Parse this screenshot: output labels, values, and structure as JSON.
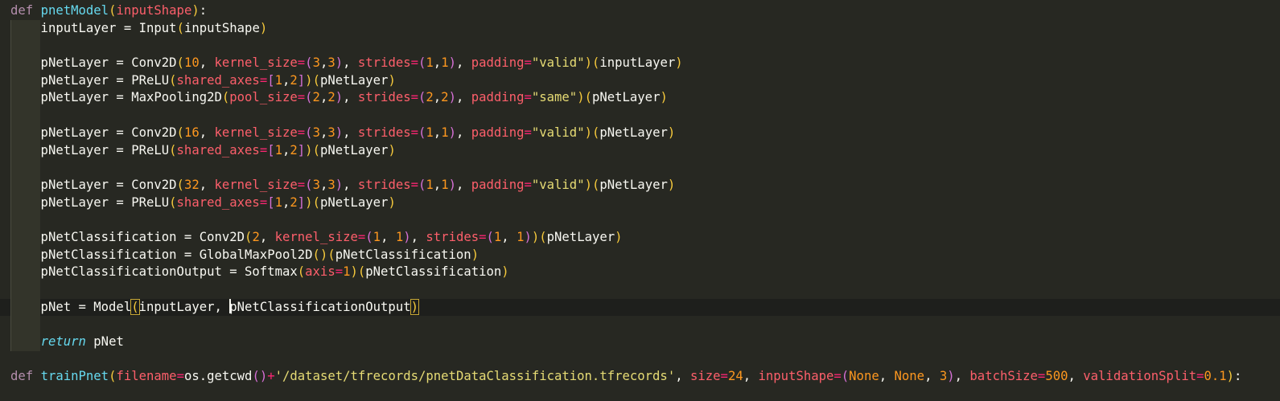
{
  "editor": {
    "lines": [
      {
        "id": 1,
        "indent": false,
        "current": false,
        "segments": [
          {
            "t": "def ",
            "c": "kw"
          },
          {
            "t": "pnetModel",
            "c": "fn"
          },
          {
            "t": "(",
            "c": "b1"
          },
          {
            "t": "inputShape",
            "c": "pa"
          },
          {
            "t": ")",
            "c": "b1"
          },
          {
            "t": ":",
            "c": "plain"
          }
        ]
      },
      {
        "id": 2,
        "indent": true,
        "current": false,
        "segments": [
          {
            "t": "    inputLayer ",
            "c": "plain"
          },
          {
            "t": "=",
            "c": "plain"
          },
          {
            "t": " Input",
            "c": "plain"
          },
          {
            "t": "(",
            "c": "b1"
          },
          {
            "t": "inputShape",
            "c": "plain"
          },
          {
            "t": ")",
            "c": "b1"
          }
        ]
      },
      {
        "id": 3,
        "indent": true,
        "current": false,
        "segments": []
      },
      {
        "id": 4,
        "indent": true,
        "current": false,
        "segments": [
          {
            "t": "    pNetLayer = Conv2D",
            "c": "plain"
          },
          {
            "t": "(",
            "c": "b1"
          },
          {
            "t": "10",
            "c": "num"
          },
          {
            "t": ", ",
            "c": "plain"
          },
          {
            "t": "kernel_size",
            "c": "pa"
          },
          {
            "t": "=",
            "c": "op"
          },
          {
            "t": "(",
            "c": "b2"
          },
          {
            "t": "3",
            "c": "num"
          },
          {
            "t": ",",
            "c": "plain"
          },
          {
            "t": "3",
            "c": "num"
          },
          {
            "t": ")",
            "c": "b2"
          },
          {
            "t": ", ",
            "c": "plain"
          },
          {
            "t": "strides",
            "c": "pa"
          },
          {
            "t": "=",
            "c": "op"
          },
          {
            "t": "(",
            "c": "b2"
          },
          {
            "t": "1",
            "c": "num"
          },
          {
            "t": ",",
            "c": "plain"
          },
          {
            "t": "1",
            "c": "num"
          },
          {
            "t": ")",
            "c": "b2"
          },
          {
            "t": ", ",
            "c": "plain"
          },
          {
            "t": "padding",
            "c": "pa"
          },
          {
            "t": "=",
            "c": "op"
          },
          {
            "t": "\"valid\"",
            "c": "str"
          },
          {
            "t": ")",
            "c": "b1"
          },
          {
            "t": "(",
            "c": "b1"
          },
          {
            "t": "inputLayer",
            "c": "plain"
          },
          {
            "t": ")",
            "c": "b1"
          }
        ]
      },
      {
        "id": 5,
        "indent": true,
        "current": false,
        "segments": [
          {
            "t": "    pNetLayer = PReLU",
            "c": "plain"
          },
          {
            "t": "(",
            "c": "b1"
          },
          {
            "t": "shared_axes",
            "c": "pa"
          },
          {
            "t": "=",
            "c": "op"
          },
          {
            "t": "[",
            "c": "b2"
          },
          {
            "t": "1",
            "c": "num"
          },
          {
            "t": ",",
            "c": "plain"
          },
          {
            "t": "2",
            "c": "num"
          },
          {
            "t": "]",
            "c": "b2"
          },
          {
            "t": ")",
            "c": "b1"
          },
          {
            "t": "(",
            "c": "b1"
          },
          {
            "t": "pNetLayer",
            "c": "plain"
          },
          {
            "t": ")",
            "c": "b1"
          }
        ]
      },
      {
        "id": 6,
        "indent": true,
        "current": false,
        "segments": [
          {
            "t": "    pNetLayer = MaxPooling2D",
            "c": "plain"
          },
          {
            "t": "(",
            "c": "b1"
          },
          {
            "t": "pool_size",
            "c": "pa"
          },
          {
            "t": "=",
            "c": "op"
          },
          {
            "t": "(",
            "c": "b2"
          },
          {
            "t": "2",
            "c": "num"
          },
          {
            "t": ",",
            "c": "plain"
          },
          {
            "t": "2",
            "c": "num"
          },
          {
            "t": ")",
            "c": "b2"
          },
          {
            "t": ", ",
            "c": "plain"
          },
          {
            "t": "strides",
            "c": "pa"
          },
          {
            "t": "=",
            "c": "op"
          },
          {
            "t": "(",
            "c": "b2"
          },
          {
            "t": "2",
            "c": "num"
          },
          {
            "t": ",",
            "c": "plain"
          },
          {
            "t": "2",
            "c": "num"
          },
          {
            "t": ")",
            "c": "b2"
          },
          {
            "t": ", ",
            "c": "plain"
          },
          {
            "t": "padding",
            "c": "pa"
          },
          {
            "t": "=",
            "c": "op"
          },
          {
            "t": "\"same\"",
            "c": "str"
          },
          {
            "t": ")",
            "c": "b1"
          },
          {
            "t": "(",
            "c": "b1"
          },
          {
            "t": "pNetLayer",
            "c": "plain"
          },
          {
            "t": ")",
            "c": "b1"
          }
        ]
      },
      {
        "id": 7,
        "indent": true,
        "current": false,
        "segments": []
      },
      {
        "id": 8,
        "indent": true,
        "current": false,
        "segments": [
          {
            "t": "    pNetLayer = Conv2D",
            "c": "plain"
          },
          {
            "t": "(",
            "c": "b1"
          },
          {
            "t": "16",
            "c": "num"
          },
          {
            "t": ", ",
            "c": "plain"
          },
          {
            "t": "kernel_size",
            "c": "pa"
          },
          {
            "t": "=",
            "c": "op"
          },
          {
            "t": "(",
            "c": "b2"
          },
          {
            "t": "3",
            "c": "num"
          },
          {
            "t": ",",
            "c": "plain"
          },
          {
            "t": "3",
            "c": "num"
          },
          {
            "t": ")",
            "c": "b2"
          },
          {
            "t": ", ",
            "c": "plain"
          },
          {
            "t": "strides",
            "c": "pa"
          },
          {
            "t": "=",
            "c": "op"
          },
          {
            "t": "(",
            "c": "b2"
          },
          {
            "t": "1",
            "c": "num"
          },
          {
            "t": ",",
            "c": "plain"
          },
          {
            "t": "1",
            "c": "num"
          },
          {
            "t": ")",
            "c": "b2"
          },
          {
            "t": ", ",
            "c": "plain"
          },
          {
            "t": "padding",
            "c": "pa"
          },
          {
            "t": "=",
            "c": "op"
          },
          {
            "t": "\"valid\"",
            "c": "str"
          },
          {
            "t": ")",
            "c": "b1"
          },
          {
            "t": "(",
            "c": "b1"
          },
          {
            "t": "pNetLayer",
            "c": "plain"
          },
          {
            "t": ")",
            "c": "b1"
          }
        ]
      },
      {
        "id": 9,
        "indent": true,
        "current": false,
        "segments": [
          {
            "t": "    pNetLayer = PReLU",
            "c": "plain"
          },
          {
            "t": "(",
            "c": "b1"
          },
          {
            "t": "shared_axes",
            "c": "pa"
          },
          {
            "t": "=",
            "c": "op"
          },
          {
            "t": "[",
            "c": "b2"
          },
          {
            "t": "1",
            "c": "num"
          },
          {
            "t": ",",
            "c": "plain"
          },
          {
            "t": "2",
            "c": "num"
          },
          {
            "t": "]",
            "c": "b2"
          },
          {
            "t": ")",
            "c": "b1"
          },
          {
            "t": "(",
            "c": "b1"
          },
          {
            "t": "pNetLayer",
            "c": "plain"
          },
          {
            "t": ")",
            "c": "b1"
          }
        ]
      },
      {
        "id": 10,
        "indent": true,
        "current": false,
        "segments": []
      },
      {
        "id": 11,
        "indent": true,
        "current": false,
        "segments": [
          {
            "t": "    pNetLayer = Conv2D",
            "c": "plain"
          },
          {
            "t": "(",
            "c": "b1"
          },
          {
            "t": "32",
            "c": "num"
          },
          {
            "t": ", ",
            "c": "plain"
          },
          {
            "t": "kernel_size",
            "c": "pa"
          },
          {
            "t": "=",
            "c": "op"
          },
          {
            "t": "(",
            "c": "b2"
          },
          {
            "t": "3",
            "c": "num"
          },
          {
            "t": ",",
            "c": "plain"
          },
          {
            "t": "3",
            "c": "num"
          },
          {
            "t": ")",
            "c": "b2"
          },
          {
            "t": ", ",
            "c": "plain"
          },
          {
            "t": "strides",
            "c": "pa"
          },
          {
            "t": "=",
            "c": "op"
          },
          {
            "t": "(",
            "c": "b2"
          },
          {
            "t": "1",
            "c": "num"
          },
          {
            "t": ",",
            "c": "plain"
          },
          {
            "t": "1",
            "c": "num"
          },
          {
            "t": ")",
            "c": "b2"
          },
          {
            "t": ", ",
            "c": "plain"
          },
          {
            "t": "padding",
            "c": "pa"
          },
          {
            "t": "=",
            "c": "op"
          },
          {
            "t": "\"valid\"",
            "c": "str"
          },
          {
            "t": ")",
            "c": "b1"
          },
          {
            "t": "(",
            "c": "b1"
          },
          {
            "t": "pNetLayer",
            "c": "plain"
          },
          {
            "t": ")",
            "c": "b1"
          }
        ]
      },
      {
        "id": 12,
        "indent": true,
        "current": false,
        "segments": [
          {
            "t": "    pNetLayer = PReLU",
            "c": "plain"
          },
          {
            "t": "(",
            "c": "b1"
          },
          {
            "t": "shared_axes",
            "c": "pa"
          },
          {
            "t": "=",
            "c": "op"
          },
          {
            "t": "[",
            "c": "b2"
          },
          {
            "t": "1",
            "c": "num"
          },
          {
            "t": ",",
            "c": "plain"
          },
          {
            "t": "2",
            "c": "num"
          },
          {
            "t": "]",
            "c": "b2"
          },
          {
            "t": ")",
            "c": "b1"
          },
          {
            "t": "(",
            "c": "b1"
          },
          {
            "t": "pNetLayer",
            "c": "plain"
          },
          {
            "t": ")",
            "c": "b1"
          }
        ]
      },
      {
        "id": 13,
        "indent": true,
        "current": false,
        "segments": []
      },
      {
        "id": 14,
        "indent": true,
        "current": false,
        "segments": [
          {
            "t": "    pNetClassification = Conv2D",
            "c": "plain"
          },
          {
            "t": "(",
            "c": "b1"
          },
          {
            "t": "2",
            "c": "num"
          },
          {
            "t": ", ",
            "c": "plain"
          },
          {
            "t": "kernel_size",
            "c": "pa"
          },
          {
            "t": "=",
            "c": "op"
          },
          {
            "t": "(",
            "c": "b2"
          },
          {
            "t": "1",
            "c": "num"
          },
          {
            "t": ", ",
            "c": "plain"
          },
          {
            "t": "1",
            "c": "num"
          },
          {
            "t": ")",
            "c": "b2"
          },
          {
            "t": ", ",
            "c": "plain"
          },
          {
            "t": "strides",
            "c": "pa"
          },
          {
            "t": "=",
            "c": "op"
          },
          {
            "t": "(",
            "c": "b2"
          },
          {
            "t": "1",
            "c": "num"
          },
          {
            "t": ", ",
            "c": "plain"
          },
          {
            "t": "1",
            "c": "num"
          },
          {
            "t": ")",
            "c": "b2"
          },
          {
            "t": ")",
            "c": "b1"
          },
          {
            "t": "(",
            "c": "b1"
          },
          {
            "t": "pNetLayer",
            "c": "plain"
          },
          {
            "t": ")",
            "c": "b1"
          }
        ]
      },
      {
        "id": 15,
        "indent": true,
        "current": false,
        "segments": [
          {
            "t": "    pNetClassification = GlobalMaxPool2D",
            "c": "plain"
          },
          {
            "t": "()",
            "c": "b1"
          },
          {
            "t": "(",
            "c": "b1"
          },
          {
            "t": "pNetClassification",
            "c": "plain"
          },
          {
            "t": ")",
            "c": "b1"
          }
        ]
      },
      {
        "id": 16,
        "indent": true,
        "current": false,
        "segments": [
          {
            "t": "    pNetClassificationOutput = Softmax",
            "c": "plain"
          },
          {
            "t": "(",
            "c": "b1"
          },
          {
            "t": "axis",
            "c": "pa"
          },
          {
            "t": "=",
            "c": "op"
          },
          {
            "t": "1",
            "c": "num"
          },
          {
            "t": ")",
            "c": "b1"
          },
          {
            "t": "(",
            "c": "b1"
          },
          {
            "t": "pNetClassification",
            "c": "plain"
          },
          {
            "t": ")",
            "c": "b1"
          }
        ]
      },
      {
        "id": 17,
        "indent": true,
        "current": false,
        "segments": []
      },
      {
        "id": 18,
        "indent": true,
        "current": true,
        "segments": [
          {
            "t": "    pNet = Model",
            "c": "plain"
          },
          {
            "t": "(",
            "c": "b1",
            "m": true
          },
          {
            "t": "inputLayer, ",
            "c": "plain"
          },
          {
            "cursor": true
          },
          {
            "t": "pNetClassificationOutput",
            "c": "plain"
          },
          {
            "t": ")",
            "c": "b1",
            "m": true
          }
        ]
      },
      {
        "id": 19,
        "indent": true,
        "current": false,
        "segments": []
      },
      {
        "id": 20,
        "indent": true,
        "current": false,
        "segments": [
          {
            "t": "    ",
            "c": "plain"
          },
          {
            "t": "return",
            "c": "ret"
          },
          {
            "t": " pNet",
            "c": "plain"
          }
        ]
      },
      {
        "id": 21,
        "indent": false,
        "current": false,
        "segments": []
      },
      {
        "id": 22,
        "indent": false,
        "current": false,
        "segments": [
          {
            "t": "def ",
            "c": "kw"
          },
          {
            "t": "trainPnet",
            "c": "fn"
          },
          {
            "t": "(",
            "c": "b1"
          },
          {
            "t": "filename",
            "c": "pa"
          },
          {
            "t": "=",
            "c": "op"
          },
          {
            "t": "os.getcwd",
            "c": "plain"
          },
          {
            "t": "()",
            "c": "b2"
          },
          {
            "t": "+",
            "c": "op"
          },
          {
            "t": "'/dataset/tfrecords/pnetDataClassification.tfrecords'",
            "c": "str"
          },
          {
            "t": ", ",
            "c": "plain"
          },
          {
            "t": "size",
            "c": "pa"
          },
          {
            "t": "=",
            "c": "op"
          },
          {
            "t": "24",
            "c": "num"
          },
          {
            "t": ", ",
            "c": "plain"
          },
          {
            "t": "inputShape",
            "c": "pa"
          },
          {
            "t": "=",
            "c": "op"
          },
          {
            "t": "(",
            "c": "b2"
          },
          {
            "t": "None",
            "c": "num"
          },
          {
            "t": ", ",
            "c": "plain"
          },
          {
            "t": "None",
            "c": "num"
          },
          {
            "t": ", ",
            "c": "plain"
          },
          {
            "t": "3",
            "c": "num"
          },
          {
            "t": ")",
            "c": "b2"
          },
          {
            "t": ", ",
            "c": "plain"
          },
          {
            "t": "batchSize",
            "c": "pa"
          },
          {
            "t": "=",
            "c": "op"
          },
          {
            "t": "500",
            "c": "num"
          },
          {
            "t": ", ",
            "c": "plain"
          },
          {
            "t": "validationSplit",
            "c": "pa"
          },
          {
            "t": "=",
            "c": "op"
          },
          {
            "t": "0.1",
            "c": "num"
          },
          {
            "t": ")",
            "c": "b1"
          },
          {
            "t": ":",
            "c": "plain"
          }
        ]
      }
    ]
  }
}
